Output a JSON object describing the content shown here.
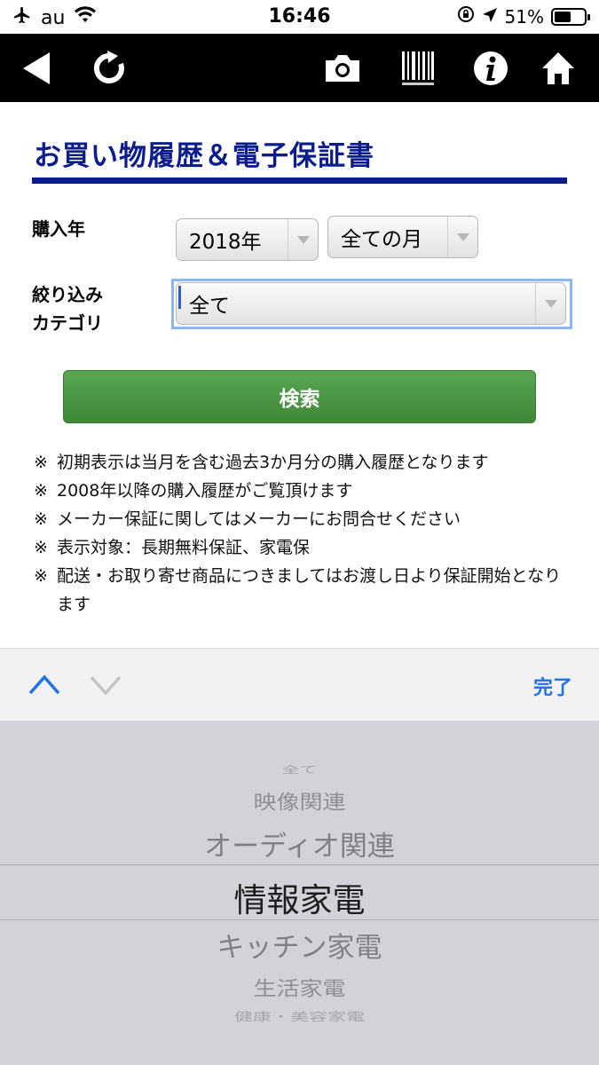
{
  "status_bar": {
    "carrier": "au",
    "time": "16:46",
    "battery": "51%"
  },
  "toolbar": {
    "icons": [
      "back-arrow-icon",
      "reload-icon",
      "camera-icon",
      "barcode-icon",
      "info-icon",
      "home-icon"
    ]
  },
  "page": {
    "title": "お買い物履歴＆電子保証書"
  },
  "form": {
    "year_label": "購入年",
    "year_value": "2018年",
    "month_value": "全ての月",
    "category_label_line1": "絞り込み",
    "category_label_line2": "カテゴリ",
    "category_value": "全て",
    "search_label": "検索"
  },
  "notes": [
    {
      "mark": "※",
      "text": "初期表示は当月を含む過去3か月分の購入履歴となります"
    },
    {
      "mark": "※",
      "text": "2008年以降の購入履歴がご覧頂けます"
    },
    {
      "mark": "※",
      "text": "メーカー保証に関してはメーカーにお問合せください"
    },
    {
      "mark": "※",
      "text": "表示対象：長期無料保証、家電保"
    },
    {
      "mark": "※",
      "text": "配送・お取り寄せ商品につきましてはお渡し日より保証開始となります"
    }
  ],
  "accessory": {
    "done_label": "完了"
  },
  "picker": {
    "items": [
      "全て",
      "映像関連",
      "オーディオ関連",
      "情報家電",
      "キッチン家電",
      "生活家電",
      "健康・美容家電"
    ],
    "selected": "情報家電"
  },
  "colors": {
    "title_blue": "#0b1c8c",
    "search_green": "#4a9744",
    "ios_blue": "#1d73e6"
  }
}
